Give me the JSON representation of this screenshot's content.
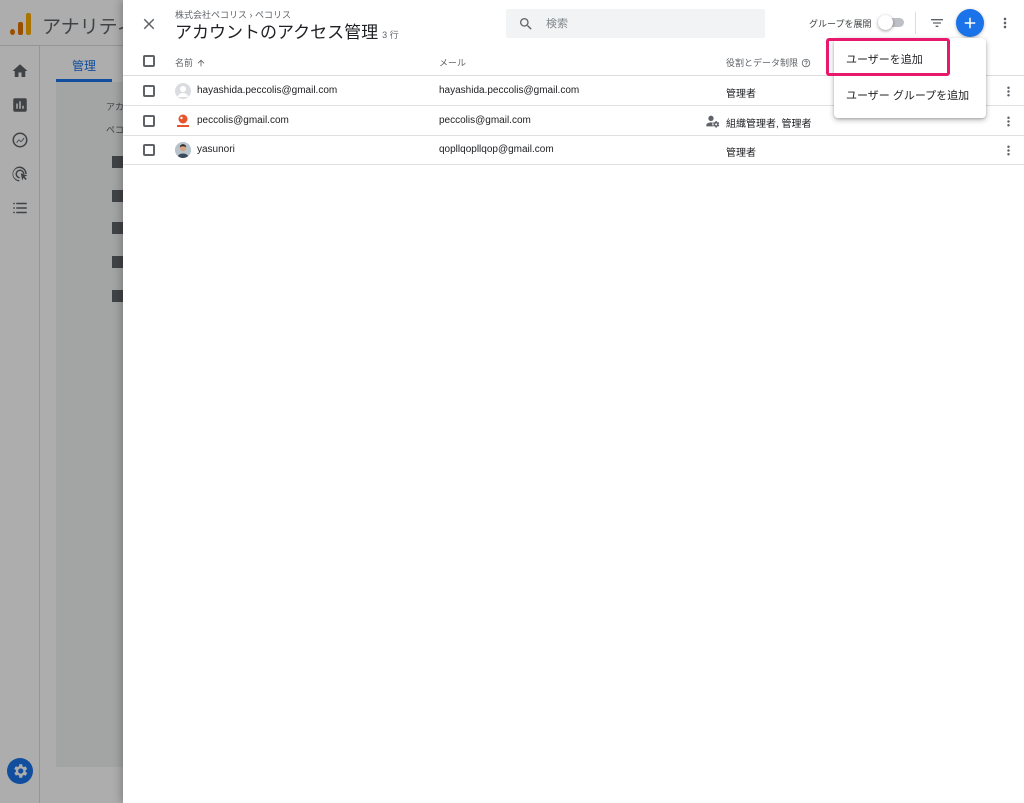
{
  "background": {
    "app_title": "アナリティ",
    "admin_tab": "管理",
    "panel_text_1": "アカ",
    "panel_text_2": "ペコ"
  },
  "dialog": {
    "breadcrumb": "株式会社ペコリス › ペコリス",
    "title": "アカウントのアクセス管理",
    "row_count": "3 行",
    "search_placeholder": "検索",
    "group_expand_label": "グループを展開",
    "group_expand_on": false,
    "accent_color": "#1a73e8",
    "highlight_color": "#e8186d"
  },
  "table": {
    "columns": {
      "name": "名前",
      "email": "メール",
      "role": "役割とデータ制限"
    },
    "rows": [
      {
        "name": "hayashida.peccolis@gmail.com",
        "email": "hayashida.peccolis@gmail.com",
        "role": "管理者",
        "avatar": "default-avatar-icon"
      },
      {
        "name": "peccolis@gmail.com",
        "email": "peccolis@gmail.com",
        "role": "組織管理者, 管理者",
        "avatar": "brand-avatar",
        "role_icon": "manage-accounts-icon"
      },
      {
        "name": "yasunori",
        "email": "qopllqopllqop@gmail.com",
        "role": "管理者",
        "avatar": "photo-avatar"
      }
    ]
  },
  "menu": {
    "items": [
      "ユーザーを追加",
      "ユーザー グループを追加"
    ]
  }
}
